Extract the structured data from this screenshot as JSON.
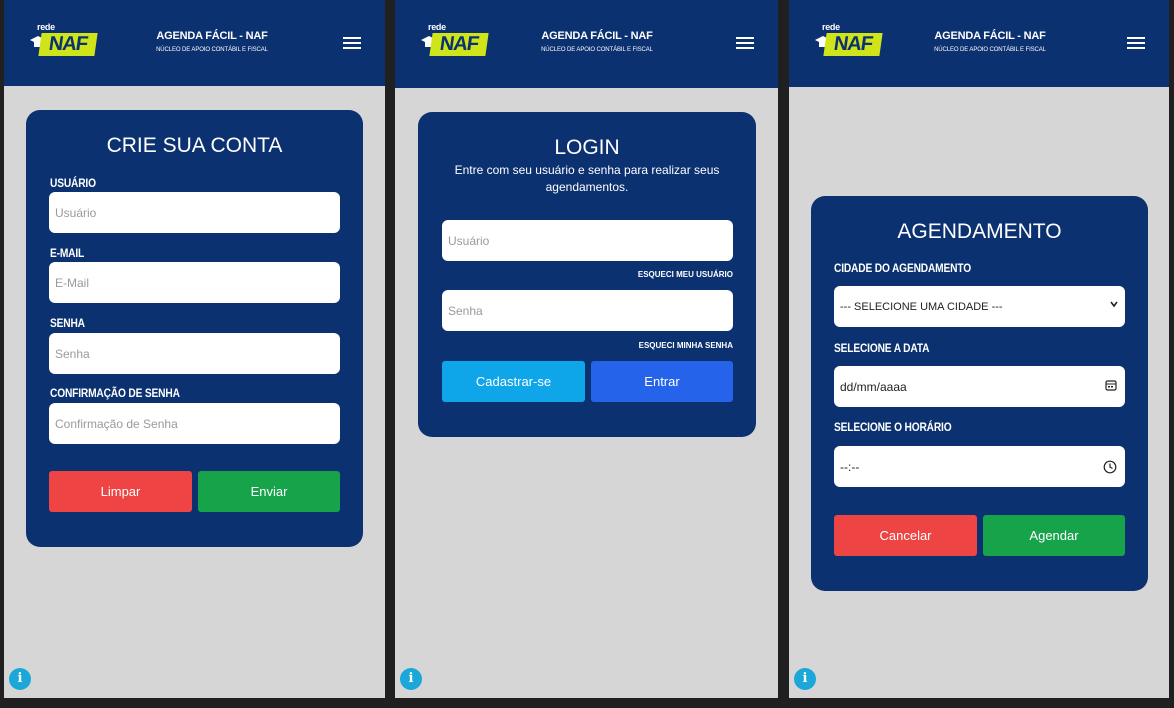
{
  "header": {
    "logo_small": "rede",
    "logo_big": "NAF",
    "title": "AGENDA FÁCIL - NAF",
    "subtitle": "NÚCLEO DE APOIO CONTÁBIL E FISCAL",
    "menu_icon": "hamburger-icon"
  },
  "register": {
    "title": "CRIE SUA CONTA",
    "fields": [
      {
        "label": "USUÁRIO",
        "placeholder": "Usuário"
      },
      {
        "label": "E-MAIL",
        "placeholder": "E-Mail"
      },
      {
        "label": "SENHA",
        "placeholder": "Senha"
      },
      {
        "label": "CONFIRMAÇÃO DE SENHA",
        "placeholder": "Confirmação de Senha"
      }
    ],
    "clear_label": "Limpar",
    "submit_label": "Enviar"
  },
  "login": {
    "title": "LOGIN",
    "subtitle": "Entre com seu usuário e senha para realizar seus agendamentos.",
    "user_placeholder": "Usuário",
    "forgot_user": "ESQUECI MEU USUÁRIO",
    "password_placeholder": "Senha",
    "forgot_password": "ESQUECI MINHA SENHA",
    "register_label": "Cadastrar-se",
    "enter_label": "Entrar"
  },
  "schedule": {
    "title": "AGENDAMENTO",
    "city_label": "CIDADE DO AGENDAMENTO",
    "city_value": "--- SELECIONE UMA CIDADE ---",
    "date_label": "SELECIONE A DATA",
    "date_value": "dd/mm/aaaa",
    "time_label": "SELECIONE O HORÁRIO",
    "time_value": "--:--",
    "cancel_label": "Cancelar",
    "submit_label": "Agendar"
  },
  "info_icon": "i",
  "colors": {
    "navy": "#0c3170",
    "background": "#d6d6d6",
    "logo_green": "#cfe51a",
    "red": "#ef4444",
    "green": "#16a34a",
    "cyan": "#0ea5e9",
    "blue": "#2563eb",
    "info": "#1ba8d8"
  }
}
